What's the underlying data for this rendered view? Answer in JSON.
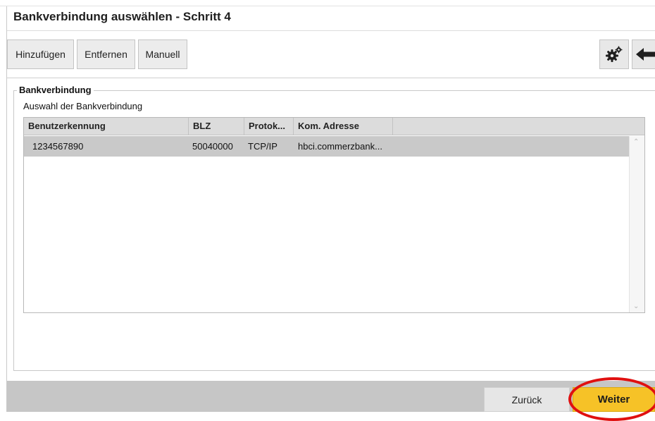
{
  "window": {
    "title": "Bankverbindung auswählen - Schritt 4"
  },
  "toolbar": {
    "add_label": "Hinzufügen",
    "remove_label": "Entfernen",
    "manual_label": "Manuell",
    "settings_icon": "gear-icon",
    "back_icon": "arrow-left-icon"
  },
  "group": {
    "legend": "Bankverbindung",
    "description": "Auswahl der Bankverbindung"
  },
  "table": {
    "columns": [
      "Benutzerkennung",
      "BLZ",
      "Protok...",
      "Kom. Adresse"
    ],
    "rows": [
      {
        "user_id": "1234567890",
        "blz": "50040000",
        "protocol": "TCP/IP",
        "address": "hbci.commerzbank..."
      }
    ]
  },
  "footer": {
    "back_label": "Zurück",
    "next_label": "Weiter"
  },
  "colors": {
    "accent": "#f6c227",
    "highlight": "#e01010",
    "selected_row": "#c9c9c9"
  }
}
